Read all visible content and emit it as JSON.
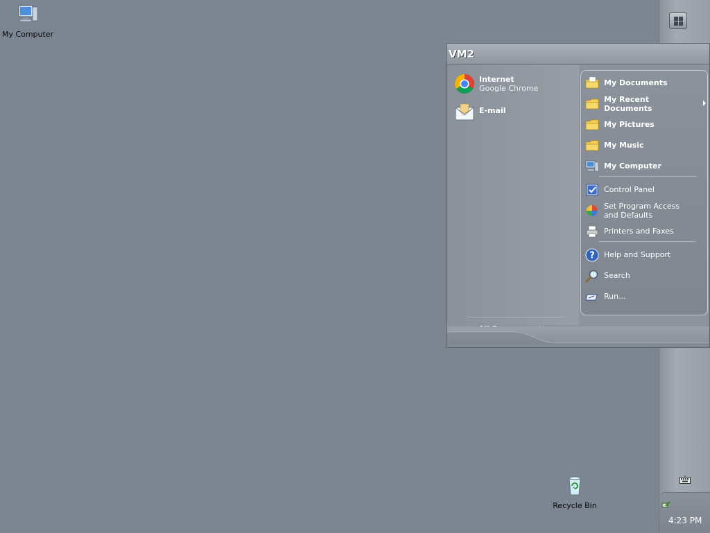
{
  "desktop": {
    "icons": [
      {
        "label": "My Computer"
      },
      {
        "label": "Recycle Bin"
      }
    ]
  },
  "start_menu": {
    "user": "VM2",
    "pinned": [
      {
        "title": "Internet",
        "subtitle": "Google Chrome",
        "icon": "chrome-icon"
      },
      {
        "title": "E-mail",
        "subtitle": "",
        "icon": "email-icon"
      }
    ],
    "all_programs": "All Programs",
    "right_items": [
      {
        "label": "My Documents",
        "icon": "folder-icon"
      },
      {
        "label": "My Recent Documents",
        "icon": "folder-icon",
        "submenu": true
      },
      {
        "label": "My Pictures",
        "icon": "folder-icon"
      },
      {
        "label": "My Music",
        "icon": "folder-icon"
      },
      {
        "label": "My Computer",
        "icon": "computer-icon"
      },
      {
        "label": "Control Panel",
        "icon": "control-panel-icon"
      },
      {
        "label": "Set Program Access and Defaults",
        "icon": "program-access-icon"
      },
      {
        "label": "Printers and Faxes",
        "icon": "printer-icon"
      },
      {
        "label": "Help and Support",
        "icon": "help-icon"
      },
      {
        "label": "Search",
        "icon": "search-icon"
      },
      {
        "label": "Run...",
        "icon": "run-icon"
      }
    ]
  },
  "taskbar": {
    "clock": "4:23 PM"
  },
  "colors": {
    "desktop": "#7c8592",
    "taskbar": "#9ba1a9",
    "menu": "#8c939c"
  }
}
